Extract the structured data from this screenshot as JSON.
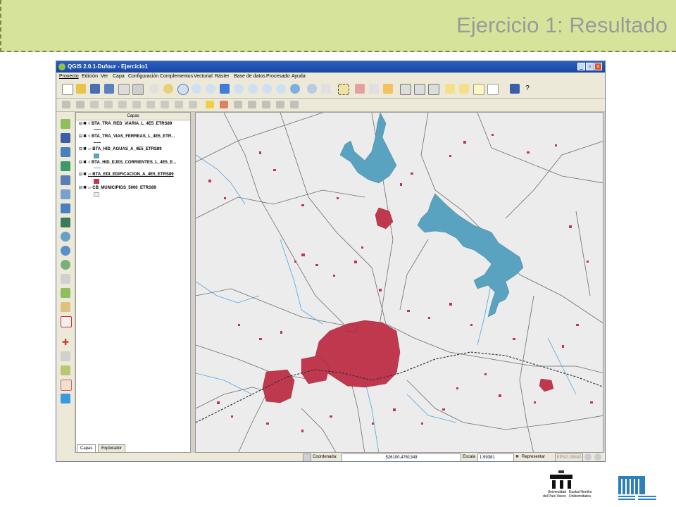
{
  "slide": {
    "title": "Ejercicio 1: Resultado"
  },
  "window": {
    "title": "QGIS 2.0.1-Dufour - Ejercicio1"
  },
  "menu": [
    "Proyecto",
    "Edición",
    "Ver",
    "Capa",
    "Configuración",
    "Complementos",
    "Vectorial",
    "Ráster",
    "Base de datos",
    "Procesado",
    "Ayuda"
  ],
  "panel": {
    "title": "Capas",
    "layers": [
      {
        "name": "BTA_TRA_RED_VIARIA_L_4E5_ETRS89",
        "color": "#555555",
        "type": "line"
      },
      {
        "name": "BTA_TRA_VIAS_FERREAS_L_4E5_ETR...",
        "color": "#333333",
        "type": "rail"
      },
      {
        "name": "BTA_HID_AGUAS_A_4E5_ETRS89",
        "color": "#5aa3c0",
        "type": "polygon"
      },
      {
        "name": "BTA_HID_EJES_CORRIENTES_L_4E5_E...",
        "color": "#4ea6e6",
        "type": "line"
      },
      {
        "name": "BTA_EDI_EDIFICACION_A_4E5_ETRS89",
        "color": "#c0384d",
        "type": "polygon"
      },
      {
        "name": "CB_MUNICIPIOS_5000_ETRS89",
        "color": "#eeeeee",
        "type": "polygon"
      }
    ],
    "tabs": [
      "Capas",
      "Explorador"
    ]
  },
  "status": {
    "coord_label": "Coordenada:",
    "coord_value": "526100,4761349",
    "scale_label": "Escala",
    "scale_value": "1:99381",
    "render_label": "Representar",
    "crs": "EPSG:25830"
  },
  "colors": {
    "water": "#5aa3c0",
    "buildings": "#c0384d",
    "roads": "#6e6e6e",
    "rivers": "#4ea6e6",
    "map_bg": "#ececec",
    "banner": "#d6e49b"
  },
  "logos": {
    "upv_line1": "Universidad",
    "upv_line2": "del País Vasco",
    "ehu_line1": "Euskal Herriko",
    "ehu_line2": "Unibertsitatea"
  }
}
